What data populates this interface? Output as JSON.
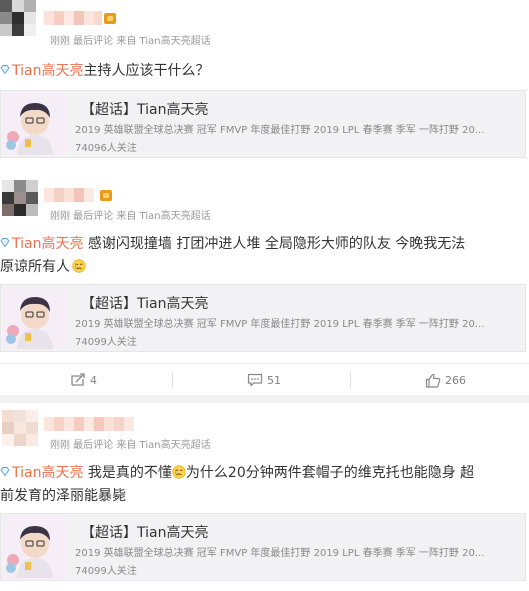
{
  "posts": [
    {
      "meta": "刚刚 最后评论 来自 Tian高天亮超话",
      "topic": "Tian高天亮",
      "body": "主持人应该干什么？",
      "card": {
        "title": "【超话】Tian高天亮",
        "desc": "2019 英雄联盟全球总决赛 冠军 FMVP 年度最佳打野 2019 LPL 春季赛 季军 一阵打野 20...",
        "count": "74096人关注"
      }
    },
    {
      "meta": "刚刚 最后评论 来自 Tian高天亮超话",
      "topic": "Tian高天亮",
      "body_line1": " 感谢闪现撞墙 打团冲进人堆 全局隐形大师的队友 今晚我无法",
      "body_line2": "原谅所有人",
      "card": {
        "title": "【超话】Tian高天亮",
        "desc": "2019 英雄联盟全球总决赛 冠军 FMVP 年度最佳打野 2019 LPL 春季赛 季军 一阵打野 20...",
        "count": "74099人关注"
      },
      "actions": {
        "repost": "4",
        "comment": "51",
        "like": "266"
      }
    },
    {
      "meta": "刚刚 最后评论 来自 Tian高天亮超话",
      "topic": "Tian高天亮",
      "body_line1a": " 我是真的不懂",
      "body_line1b": "为什么20分钟两件套帽子的维克托也能隐身 超",
      "body_line2": "前发育的泽丽能暴毙",
      "card": {
        "title": "【超话】Tian高天亮",
        "desc": "2019 英雄联盟全球总决赛 冠军 FMVP 年度最佳打野 2019 LPL 春季赛 季军 一阵打野 20...",
        "count": "74099人关注"
      }
    }
  ],
  "icons": {
    "topic_tag": "diamond-tag-icon",
    "repost": "repost-icon",
    "comment": "comment-icon",
    "like": "thumbs-up-icon",
    "emoji": "crying-emoji-icon"
  },
  "colors": {
    "topic": "#eb7350",
    "meta": "#999999",
    "card_bg": "#f2f2f5"
  }
}
